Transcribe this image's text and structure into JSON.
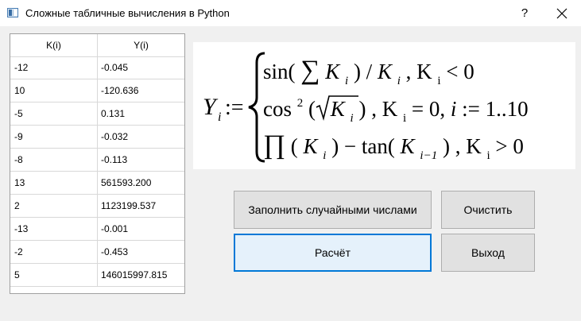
{
  "window": {
    "title": "Сложные табличные вычисления в Python",
    "help_label": "?",
    "icons": {
      "app": "app-window-icon",
      "close": "close-icon"
    }
  },
  "table": {
    "headers": {
      "k": "K(i)",
      "y": "Y(i)"
    },
    "rows": [
      {
        "k": "-12",
        "y": "-0.045"
      },
      {
        "k": "10",
        "y": "-120.636"
      },
      {
        "k": "-5",
        "y": "0.131"
      },
      {
        "k": "-9",
        "y": "-0.032"
      },
      {
        "k": "-8",
        "y": "-0.113"
      },
      {
        "k": "13",
        "y": "561593.200"
      },
      {
        "k": "2",
        "y": "1123199.537"
      },
      {
        "k": "-13",
        "y": "-0.001"
      },
      {
        "k": "-2",
        "y": "-0.453"
      },
      {
        "k": "5",
        "y": "146015997.815"
      }
    ]
  },
  "formula": {
    "lhs": "Y",
    "lhs_sub": "i",
    "assign": ":=",
    "line1": {
      "fn": "sin(",
      "sum": "∑",
      "var": "K",
      "sub": "i",
      "mid": ") / ",
      "var2": "K",
      "sub2": "i",
      "cond": " , K",
      "cond_sub": "i",
      "cond_rest": " < 0"
    },
    "line2": {
      "fn": "cos",
      "power": "2",
      "open": "(",
      "var": "K",
      "sub": "i",
      "close": ")",
      "cond": " , K",
      "cond_sub": "i",
      "cond_rest": " = 0, ",
      "iter": "i",
      "iter_rest": " := 1..10"
    },
    "line3": {
      "prod": "∏",
      "open": "(",
      "var": "K",
      "sub": "i",
      "mid": ") − tan(",
      "var2": "K",
      "sub2": "i−1",
      "close": ")",
      "cond": " , K",
      "cond_sub": "i",
      "cond_rest": " > 0"
    }
  },
  "buttons": {
    "fill": "Заполнить случайными числами",
    "clear": "Очистить",
    "calc": "Расчёт",
    "exit": "Выход"
  }
}
